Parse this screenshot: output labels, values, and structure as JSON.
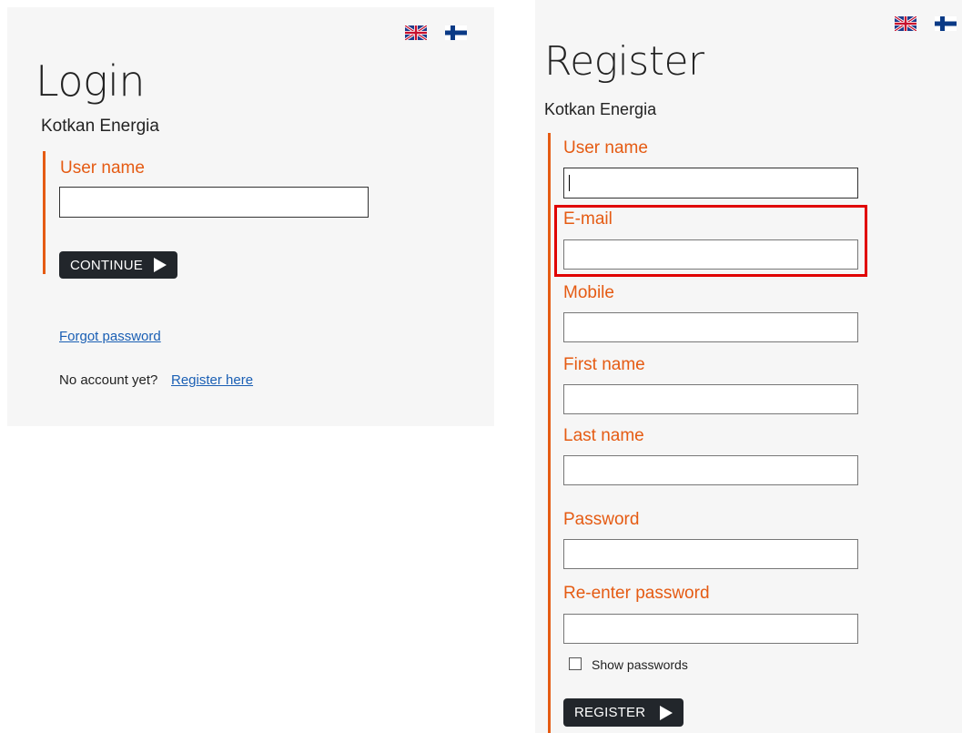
{
  "login": {
    "title": "Login",
    "subtitle": "Kotkan Energia",
    "username_label": "User name",
    "username_value": "",
    "continue_label": "CONTINUE",
    "forgot_password": "Forgot password",
    "no_account_text": "No account yet?",
    "register_link": "Register here"
  },
  "register": {
    "title": "Register",
    "subtitle": "Kotkan Energia",
    "fields": {
      "username": "User name",
      "email": "E-mail",
      "mobile": "Mobile",
      "first_name": "First name",
      "last_name": "Last name",
      "password": "Password",
      "reenter_password": "Re-enter password"
    },
    "show_passwords_label": "Show passwords",
    "register_label": "REGISTER"
  },
  "languages": [
    "english-flag-icon",
    "finnish-flag-icon"
  ],
  "colors": {
    "accent": "#e55b13",
    "button": "#22262b",
    "link": "#1a5fb4",
    "highlight": "#e00000",
    "panel": "#f6f6f6"
  }
}
